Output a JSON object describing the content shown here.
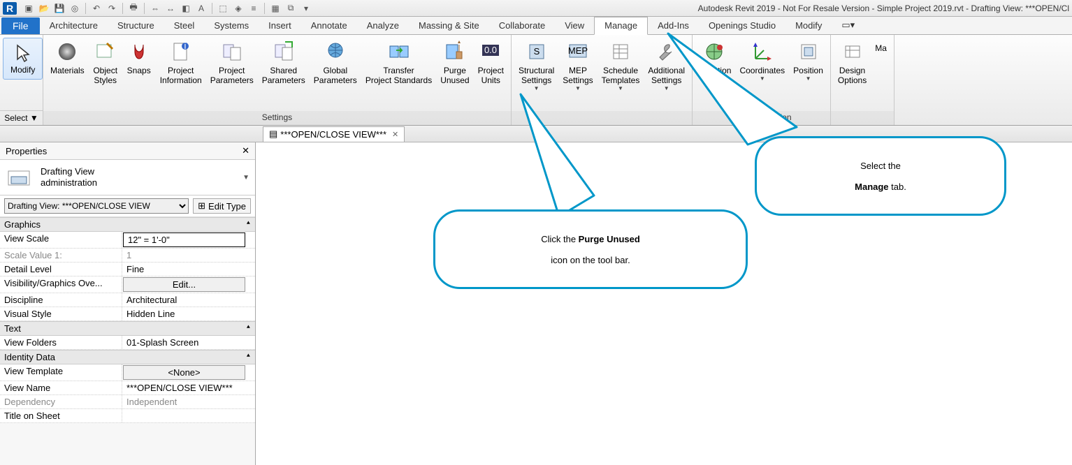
{
  "title_bar": "Autodesk Revit 2019 - Not For Resale Version - Simple Project 2019.rvt - Drafting View: ***OPEN/Cl",
  "tabs": {
    "file": "File",
    "list": [
      "Architecture",
      "Structure",
      "Steel",
      "Systems",
      "Insert",
      "Annotate",
      "Analyze",
      "Massing & Site",
      "Collaborate",
      "View",
      "Manage",
      "Add-Ins",
      "Openings Studio",
      "Modify"
    ],
    "active": "Manage"
  },
  "ribbon": {
    "modify": "Modify",
    "select": "Select ▼",
    "items": {
      "materials": "Materials",
      "object_styles": "Object\nStyles",
      "snaps": "Snaps",
      "project_info": "Project\nInformation",
      "project_params": "Project\nParameters",
      "shared_params": "Shared\nParameters",
      "global_params": "Global\nParameters",
      "transfer": "Transfer\nProject Standards",
      "purge": "Purge\nUnused",
      "units": "Project\nUnits",
      "settings_label": "Settings",
      "struct": "Structural\nSettings",
      "mep": "MEP\nSettings",
      "panel_sched": "Schedule\nTemplates",
      "addl": "Additional\nSettings",
      "location": "Location",
      "coords": "Coordinates",
      "position": "Position",
      "proj_loc": "Project Location",
      "design": "Design\nOptions",
      "ma": "Ma"
    }
  },
  "view_tab": "***OPEN/CLOSE VIEW***",
  "properties": {
    "title": "Properties",
    "type_line1": "Drafting View",
    "type_line2": "administration",
    "selector": "Drafting View: ***OPEN/CLOSE VIEW",
    "edit_type": "Edit Type",
    "groups": {
      "graphics": "Graphics",
      "text": "Text",
      "identity": "Identity Data"
    },
    "rows": {
      "view_scale_k": "View Scale",
      "view_scale_v": "12\" = 1'-0\"",
      "scale_val_k": "Scale Value    1:",
      "scale_val_v": "1",
      "detail_k": "Detail Level",
      "detail_v": "Fine",
      "vis_k": "Visibility/Graphics Ove...",
      "vis_v": "Edit...",
      "disc_k": "Discipline",
      "disc_v": "Architectural",
      "vstyle_k": "Visual Style",
      "vstyle_v": "Hidden Line",
      "vfold_k": "View Folders",
      "vfold_v": "01-Splash Screen",
      "vtmpl_k": "View Template",
      "vtmpl_v": "<None>",
      "vname_k": "View Name",
      "vname_v": "***OPEN/CLOSE VIEW***",
      "dep_k": "Dependency",
      "dep_v": "Independent",
      "title_k": "Title on Sheet"
    }
  },
  "callout1": {
    "pre": "Click the ",
    "bold": "Purge Unused",
    "post": "\nicon on the tool bar."
  },
  "callout2": {
    "pre": "Select the\n",
    "bold": "Manage",
    "post": " tab."
  }
}
